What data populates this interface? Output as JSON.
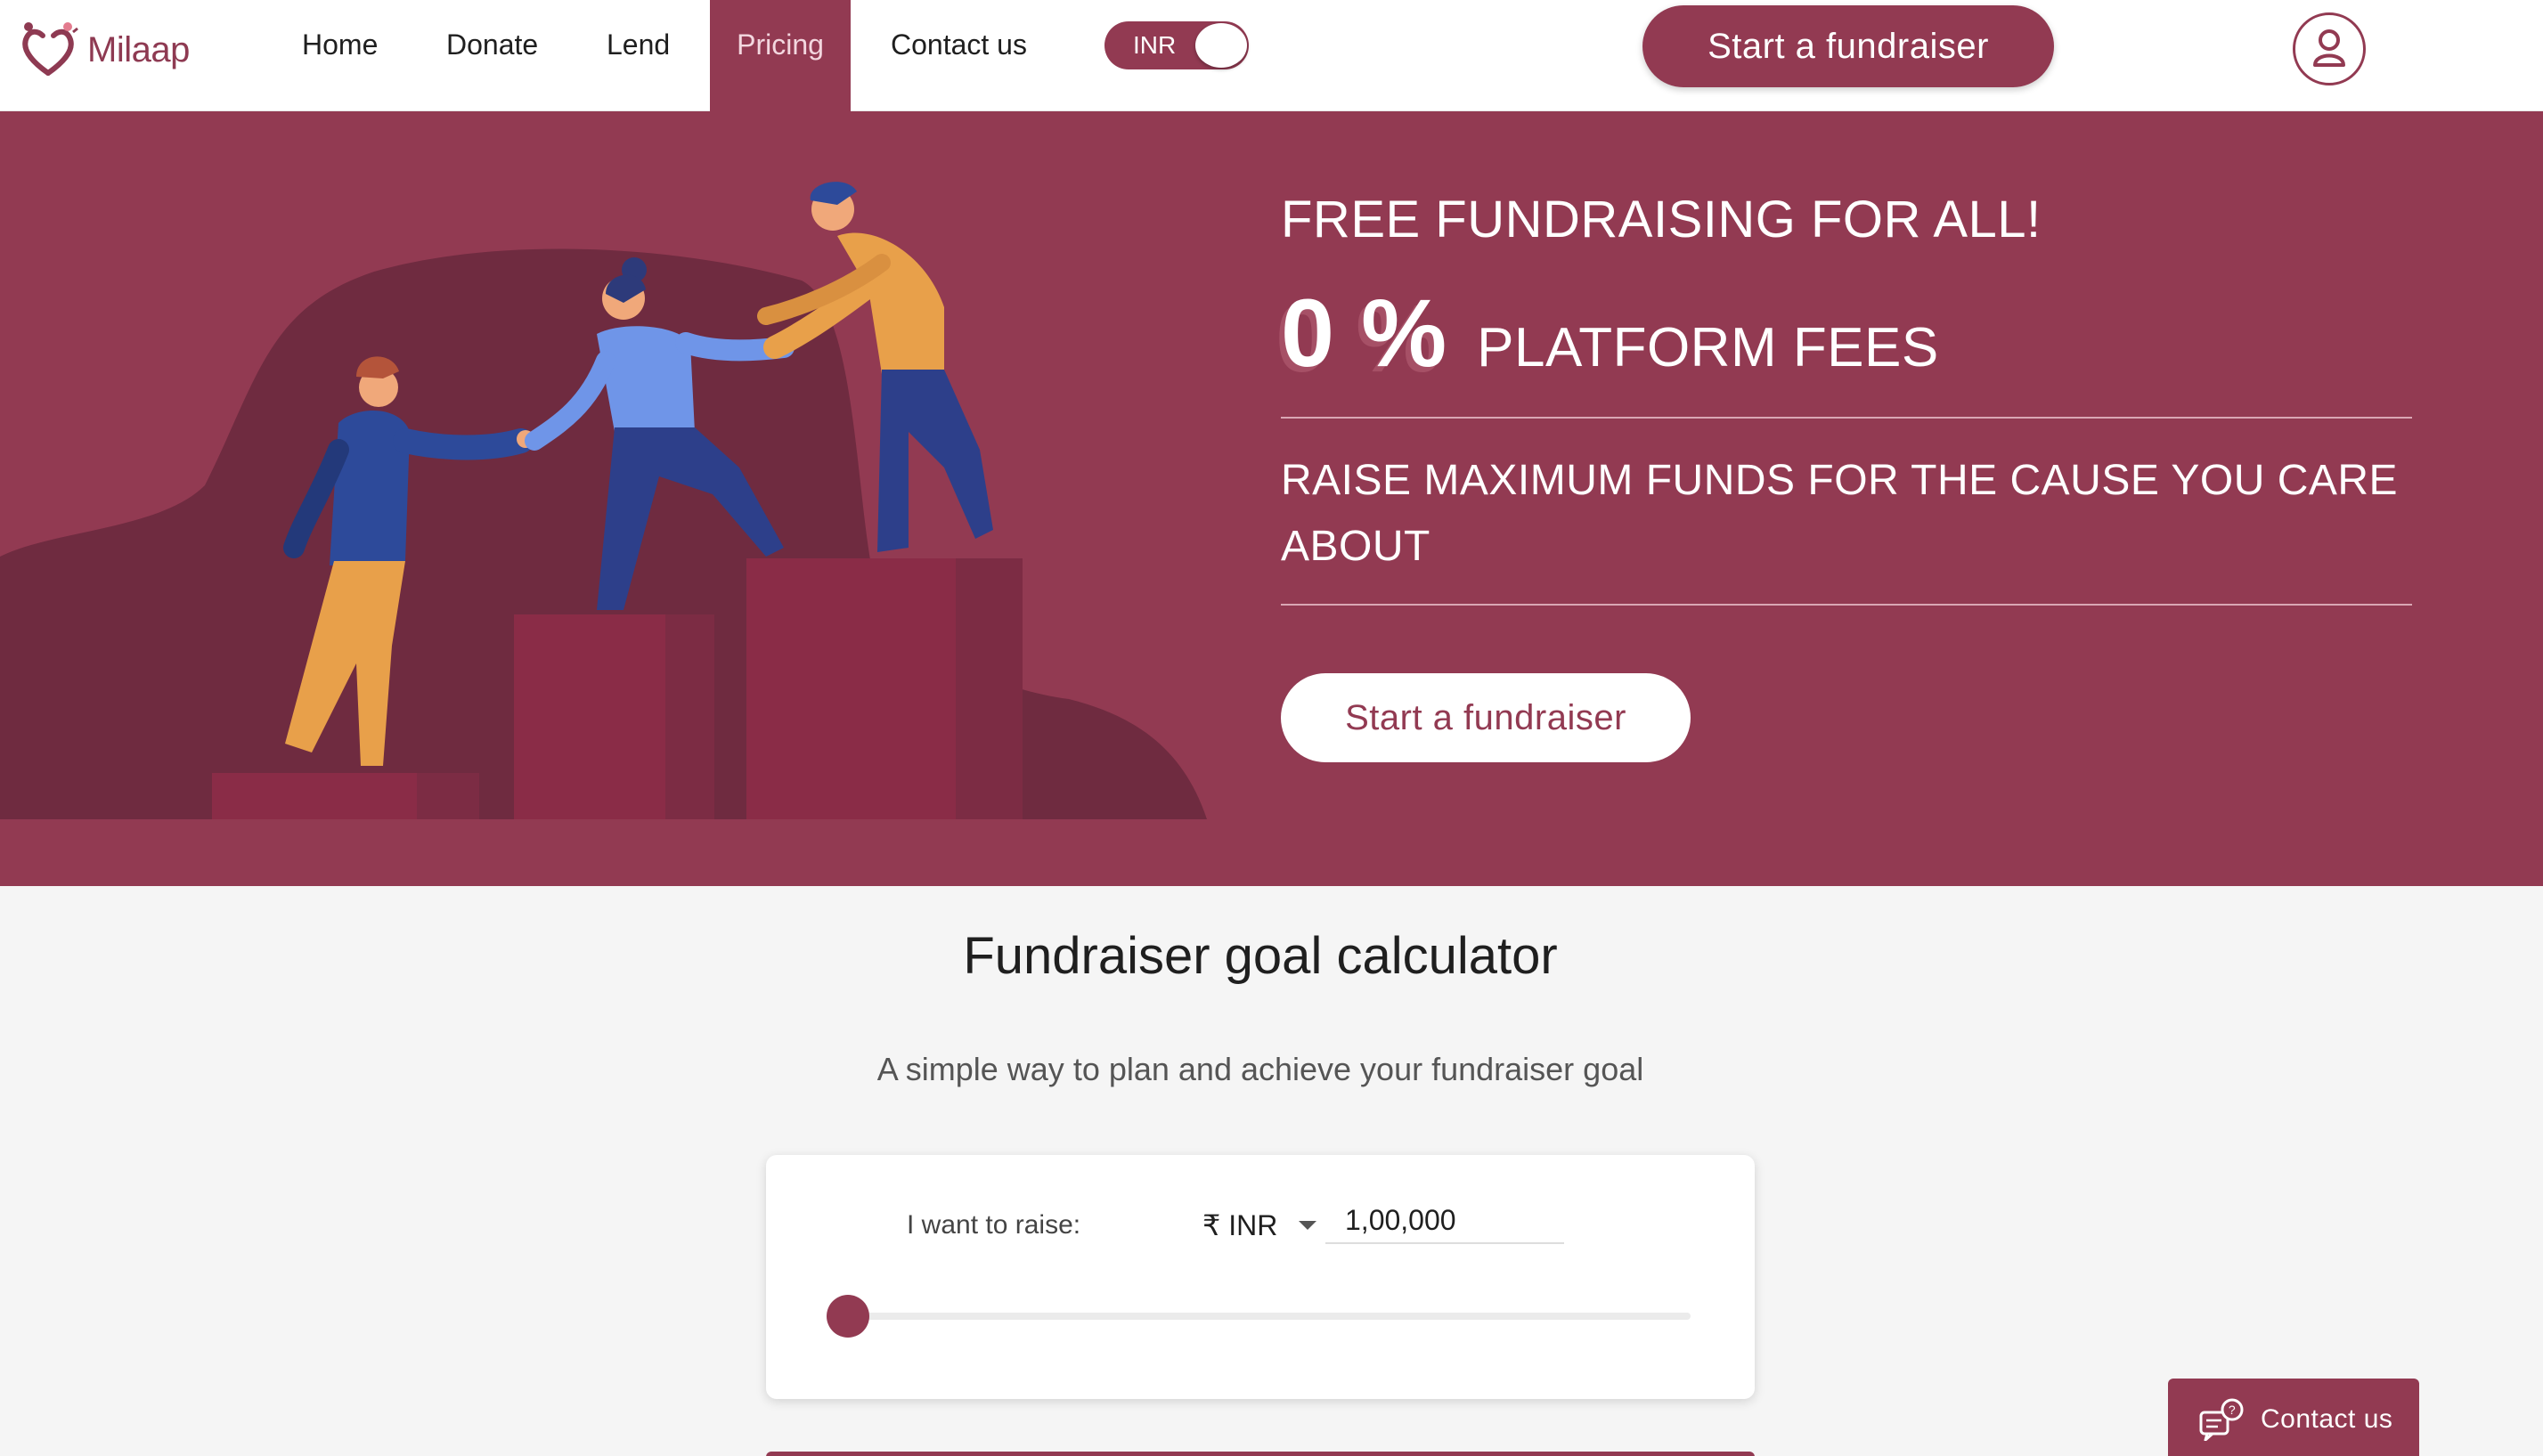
{
  "brand": {
    "name": "Milaap",
    "color": "#923a52"
  },
  "nav": {
    "links": [
      {
        "label": "Home"
      },
      {
        "label": "Donate"
      },
      {
        "label": "Lend"
      },
      {
        "label": "Pricing",
        "active": true
      },
      {
        "label": "Contact us"
      }
    ],
    "currency_toggle": "INR",
    "cta": "Start a fundraiser",
    "profile_icon": "user-icon"
  },
  "hero": {
    "title": "FREE FUNDRAISING FOR ALL!",
    "fee_value": "0 %",
    "fee_label": "PLATFORM FEES",
    "subtitle": "RAISE MAXIMUM FUNDS FOR THE CAUSE YOU CARE ABOUT",
    "cta": "Start a fundraiser"
  },
  "calculator": {
    "title": "Fundraiser goal calculator",
    "subtitle": "A simple way to plan and achieve your fundraiser goal",
    "raise_label": "I want to raise:",
    "currency": "₹ INR",
    "amount": "1,00,000",
    "slider_fraction": 0.0
  },
  "floating_contact": {
    "label": "Contact us",
    "icon": "chat-help-icon"
  }
}
